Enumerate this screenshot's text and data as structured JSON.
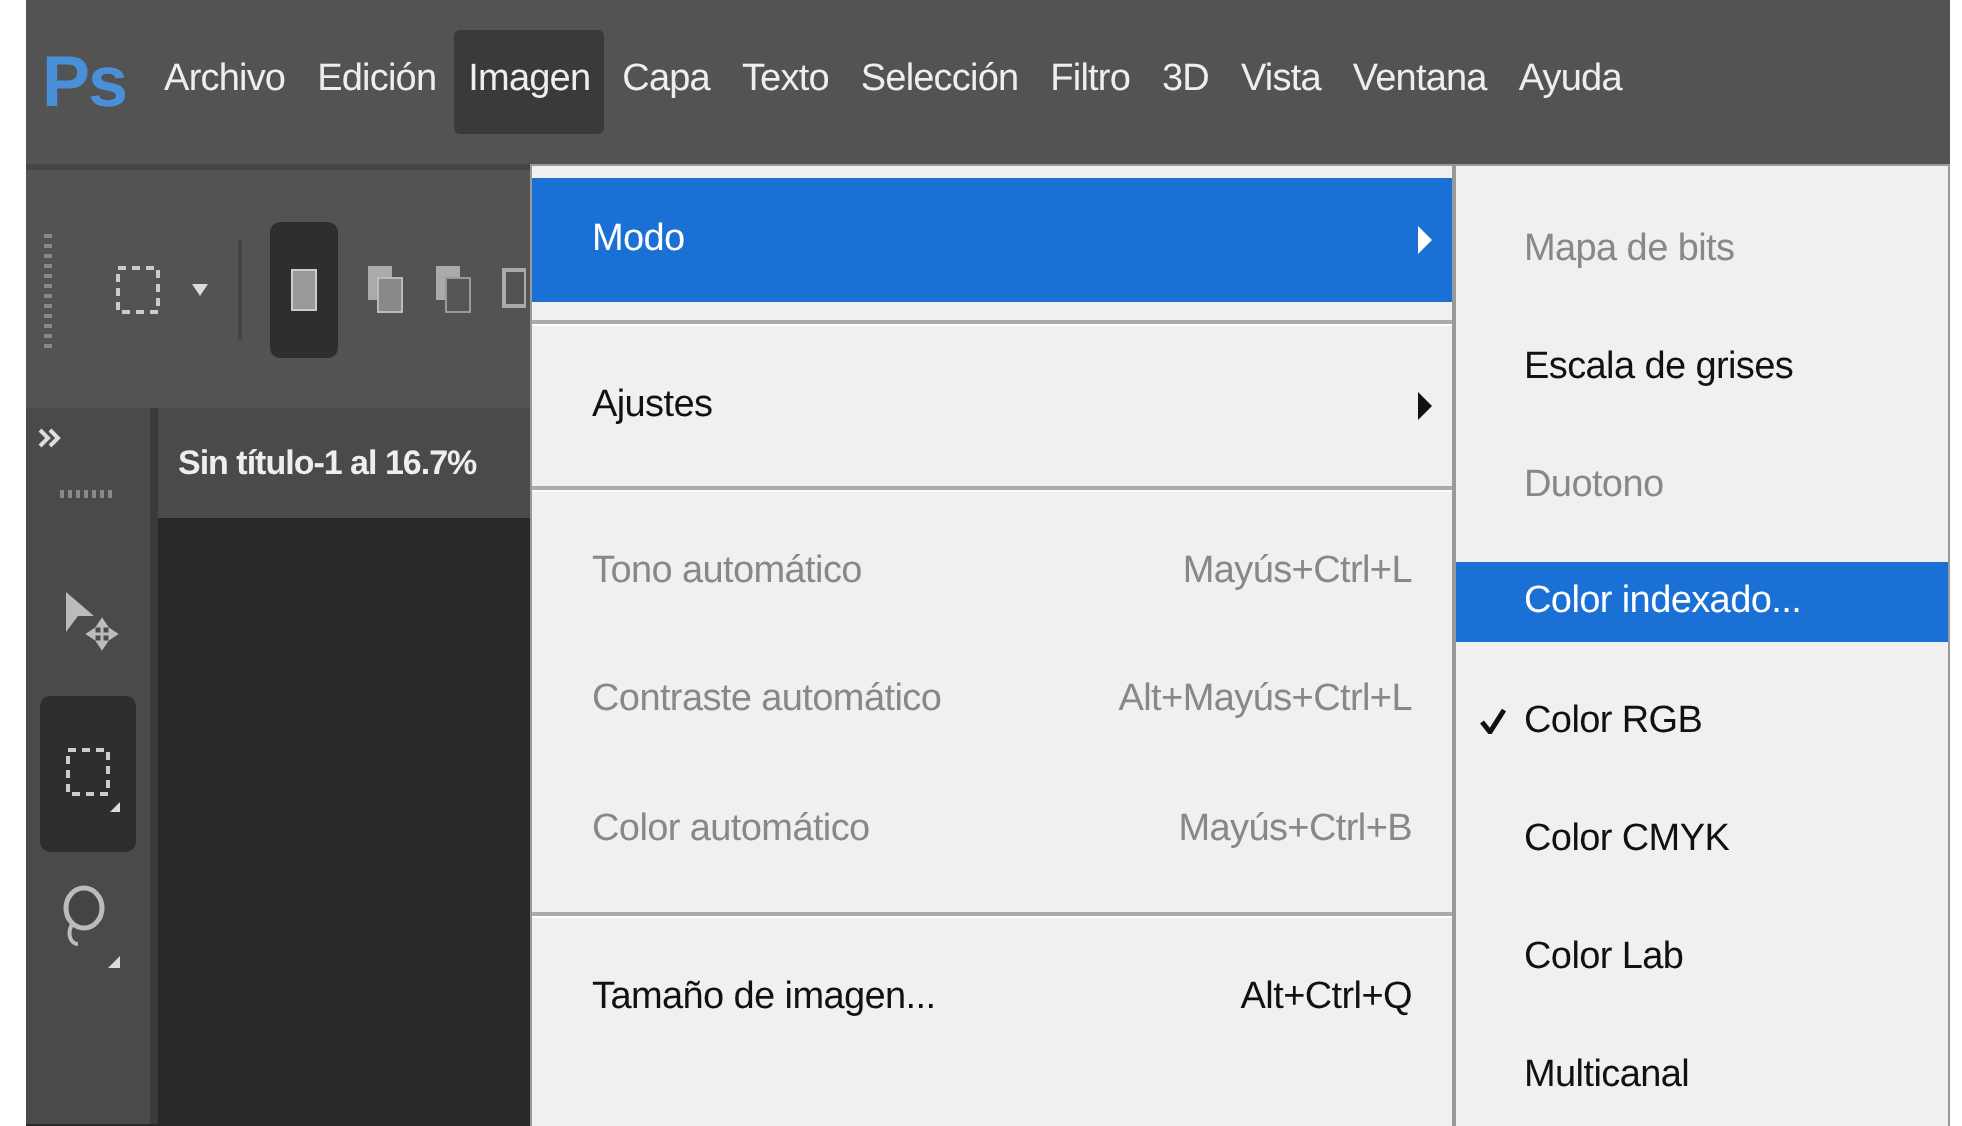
{
  "app_logo": "Ps",
  "menu_bar": [
    {
      "label": "Archivo",
      "selected": false
    },
    {
      "label": "Edición",
      "selected": false
    },
    {
      "label": "Imagen",
      "selected": true
    },
    {
      "label": "Capa",
      "selected": false
    },
    {
      "label": "Texto",
      "selected": false
    },
    {
      "label": "Selección",
      "selected": false
    },
    {
      "label": "Filtro",
      "selected": false
    },
    {
      "label": "3D",
      "selected": false
    },
    {
      "label": "Vista",
      "selected": false
    },
    {
      "label": "Ventana",
      "selected": false
    },
    {
      "label": "Ayuda",
      "selected": false
    }
  ],
  "document_tab": {
    "title": "Sin título-1 al 16.7%"
  },
  "image_menu": [
    {
      "kind": "item",
      "label": "Modo",
      "submenu": true,
      "disabled": false,
      "selected": true
    },
    {
      "kind": "separator"
    },
    {
      "kind": "item",
      "label": "Ajustes",
      "submenu": true,
      "disabled": false,
      "selected": false
    },
    {
      "kind": "separator"
    },
    {
      "kind": "item",
      "label": "Tono automático",
      "shortcut": "Mayús+Ctrl+L",
      "submenu": false,
      "disabled": true,
      "selected": false
    },
    {
      "kind": "item",
      "label": "Contraste automático",
      "shortcut": "Alt+Mayús+Ctrl+L",
      "submenu": false,
      "disabled": true,
      "selected": false
    },
    {
      "kind": "item",
      "label": "Color automático",
      "shortcut": "Mayús+Ctrl+B",
      "submenu": false,
      "disabled": true,
      "selected": false
    },
    {
      "kind": "separator"
    },
    {
      "kind": "item",
      "label": "Tamaño de imagen...",
      "shortcut": "Alt+Ctrl+Q",
      "submenu": false,
      "disabled": false,
      "selected": false
    }
  ],
  "mode_submenu": [
    {
      "label": "Mapa de bits",
      "disabled": true,
      "selected": false,
      "checked": false
    },
    {
      "label": "Escala de grises",
      "disabled": false,
      "selected": false,
      "checked": false
    },
    {
      "label": "Duotono",
      "disabled": true,
      "selected": false,
      "checked": false
    },
    {
      "label": "Color indexado...",
      "disabled": false,
      "selected": true,
      "checked": false
    },
    {
      "label": "Color RGB",
      "disabled": false,
      "selected": false,
      "checked": true
    },
    {
      "label": "Color CMYK",
      "disabled": false,
      "selected": false,
      "checked": false
    },
    {
      "label": "Color Lab",
      "disabled": false,
      "selected": false,
      "checked": false
    },
    {
      "label": "Multicanal",
      "disabled": false,
      "selected": false,
      "checked": false
    }
  ]
}
